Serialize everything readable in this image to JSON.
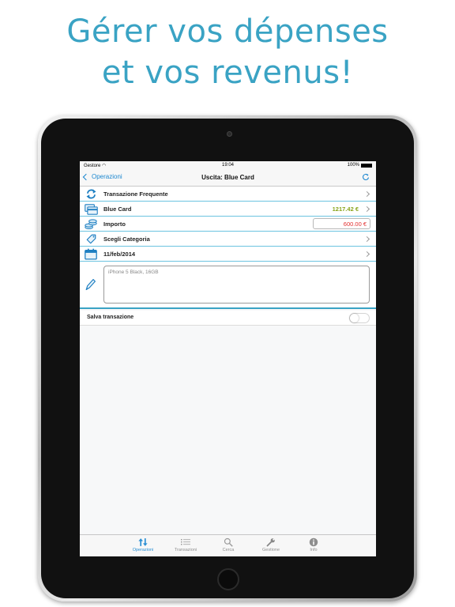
{
  "headline": {
    "line1": "Gérer vos dépenses",
    "line2": "et vos revenus!"
  },
  "status_bar": {
    "carrier": "Gestore",
    "time": "19:04",
    "battery": "100%"
  },
  "nav": {
    "back_label": "Operazioni",
    "title": "Uscita: Blue Card",
    "refresh_icon": "refresh-icon"
  },
  "rows": [
    {
      "label": "Transazione Frequente",
      "icon": "repeat-icon"
    },
    {
      "label": "Blue Card",
      "value": "1217.42 €",
      "value_color": "#8aa51d",
      "icon": "card-icon"
    },
    {
      "label": "Importo",
      "value": "600.00 €",
      "value_color": "#e23030",
      "icon": "coins-icon"
    },
    {
      "label": "Scegli Categoria",
      "icon": "tag-icon"
    },
    {
      "label": "11/feb/2014",
      "icon": "calendar-icon"
    }
  ],
  "note": {
    "placeholder": "iPhone 5 Black, 16GB",
    "icon": "pencil-icon"
  },
  "save": {
    "label": "Salva transazione",
    "on": false
  },
  "tabs": [
    {
      "label": "Operazioni",
      "icon": "updown-arrows-icon",
      "active": true
    },
    {
      "label": "Transazioni",
      "icon": "list-icon",
      "active": false
    },
    {
      "label": "Cerca",
      "icon": "search-icon",
      "active": false
    },
    {
      "label": "Gestione",
      "icon": "wrench-icon",
      "active": false
    },
    {
      "label": "Info",
      "icon": "info-icon",
      "active": false
    }
  ],
  "colors": {
    "accent": "#3aa3c4",
    "ios_blue": "#1e88d0",
    "separator": "#6cc4e0"
  }
}
